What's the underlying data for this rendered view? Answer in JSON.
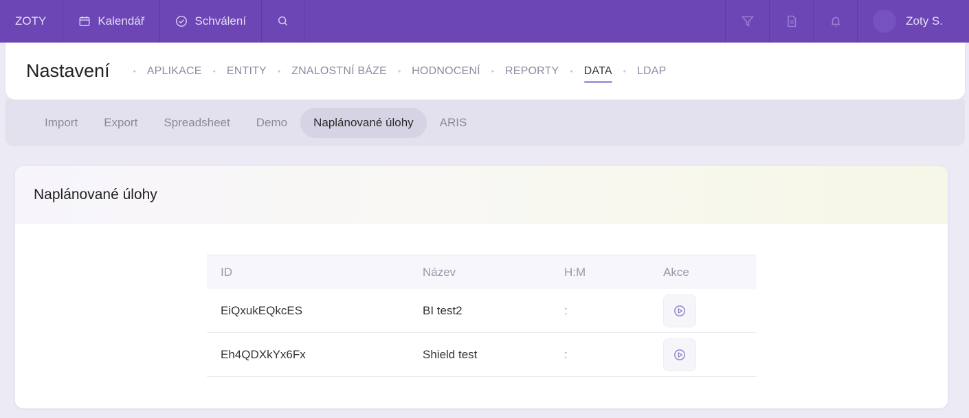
{
  "topbar": {
    "brand": "ZOTY",
    "calendar_label": "Kalendář",
    "approval_label": "Schválení",
    "user_name": "Zoty S.",
    "icons": [
      "calendar-icon",
      "check-circle-icon",
      "search-icon",
      "filter-icon",
      "document-icon",
      "bell-icon",
      "avatar"
    ]
  },
  "settings": {
    "title": "Nastavení",
    "nav": [
      "APLIKACE",
      "ENTITY",
      "ZNALOSTNÍ BÁZE",
      "HODNOCENÍ",
      "REPORTY",
      "DATA",
      "LDAP"
    ],
    "active_nav": "DATA"
  },
  "subtabs": {
    "items": [
      "Import",
      "Export",
      "Spreadsheet",
      "Demo",
      "Naplánované úlohy",
      "ARIS"
    ],
    "active": "Naplánované úlohy"
  },
  "card": {
    "title": "Naplánované úlohy",
    "columns": [
      "ID",
      "Název",
      "H:M",
      "Akce"
    ],
    "rows": [
      {
        "id": "EiQxukEQkcES",
        "name": "BI test2",
        "hm": ":"
      },
      {
        "id": "Eh4QDXkYx6Fx",
        "name": "Shield test",
        "hm": ":"
      }
    ]
  },
  "colors": {
    "topbar": "#6b46b4",
    "background": "#eceaf5",
    "active_underline": "#a99ae2"
  }
}
